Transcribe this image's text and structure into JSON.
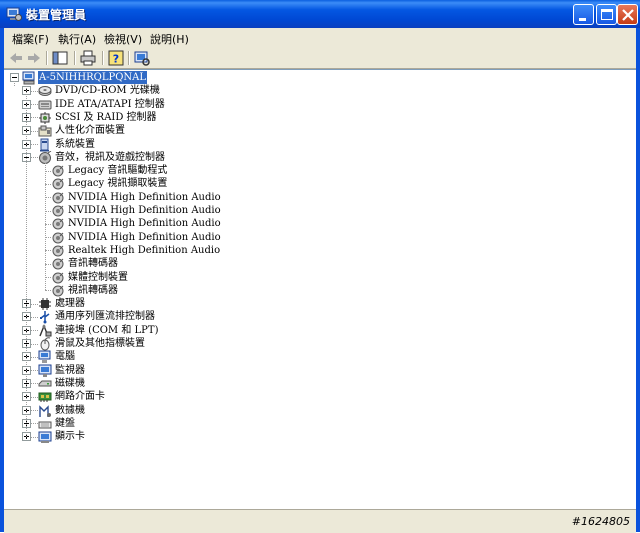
{
  "window": {
    "title": "裝置管理員"
  },
  "menu": [
    {
      "label": "檔案(F)"
    },
    {
      "label": "執行(A)"
    },
    {
      "label": "檢視(V)"
    },
    {
      "label": "說明(H)"
    }
  ],
  "tree": {
    "root": {
      "label": "A-5NIHHRQLPQNAL",
      "icon": "computer-icon",
      "expanded": true
    },
    "categories": [
      {
        "label": "DVD/CD-ROM 光碟機",
        "icon": "cdrom-icon",
        "expanded": false
      },
      {
        "label": "IDE ATA/ATAPI 控制器",
        "icon": "ide-icon",
        "expanded": false
      },
      {
        "label": "SCSI 及 RAID 控制器",
        "icon": "scsi-icon",
        "expanded": false
      },
      {
        "label": "人性化介面裝置",
        "icon": "hid-icon",
        "expanded": false
      },
      {
        "label": "系統裝置",
        "icon": "system-icon",
        "expanded": false
      },
      {
        "label": "音效，視訊及遊戲控制器",
        "icon": "sound-icon",
        "expanded": true,
        "children": [
          {
            "label": "Legacy 音訊驅動程式"
          },
          {
            "label": "Legacy 視訊擷取裝置"
          },
          {
            "label": "NVIDIA High Definition Audio"
          },
          {
            "label": "NVIDIA High Definition Audio"
          },
          {
            "label": "NVIDIA High Definition Audio"
          },
          {
            "label": "NVIDIA High Definition Audio"
          },
          {
            "label": "Realtek High Definition Audio"
          },
          {
            "label": "音訊轉碼器"
          },
          {
            "label": "媒體控制裝置"
          },
          {
            "label": "視訊轉碼器"
          }
        ]
      },
      {
        "label": "處理器",
        "icon": "processor-icon",
        "expanded": false
      },
      {
        "label": "通用序列匯流排控制器",
        "icon": "usb-icon",
        "expanded": false
      },
      {
        "label": "連接埠 (COM 和 LPT)",
        "icon": "port-icon",
        "expanded": false
      },
      {
        "label": "滑鼠及其他指標裝置",
        "icon": "mouse-icon",
        "expanded": false
      },
      {
        "label": "電腦",
        "icon": "computer-small-icon",
        "expanded": false
      },
      {
        "label": "監視器",
        "icon": "monitor-icon",
        "expanded": false
      },
      {
        "label": "磁碟機",
        "icon": "disk-icon",
        "expanded": false
      },
      {
        "label": "網路介面卡",
        "icon": "network-icon",
        "expanded": false
      },
      {
        "label": "數據機",
        "icon": "modem-icon",
        "expanded": false
      },
      {
        "label": "鍵盤",
        "icon": "keyboard-icon",
        "expanded": false
      },
      {
        "label": "顯示卡",
        "icon": "display-icon",
        "expanded": false
      }
    ]
  },
  "watermark": "#1624805"
}
